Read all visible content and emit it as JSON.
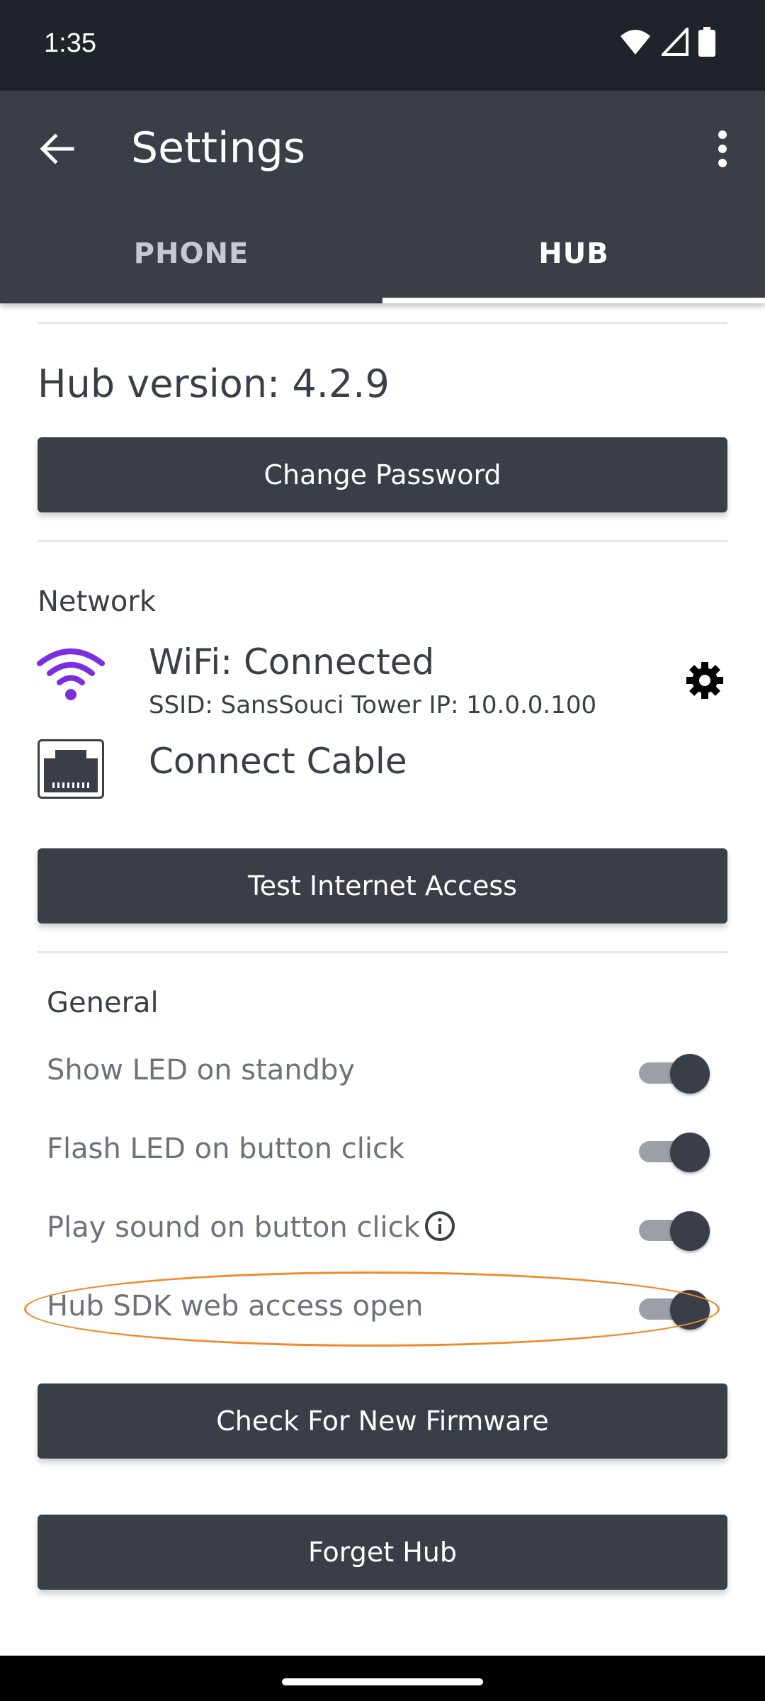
{
  "status_bar": {
    "time": "1:35"
  },
  "app_bar": {
    "title": "Settings"
  },
  "tabs": [
    {
      "label": "PHONE",
      "active": false
    },
    {
      "label": "HUB",
      "active": true
    }
  ],
  "hub": {
    "version_text": "Hub version: 4.2.9",
    "change_password_label": "Change Password"
  },
  "network": {
    "section_title": "Network",
    "wifi_status": "WiFi: Connected",
    "wifi_details": "SSID: SansSouci Tower      IP: 10.0.0.100",
    "cable_label": "Connect Cable",
    "test_internet_label": "Test Internet Access"
  },
  "general": {
    "section_title": "General",
    "settings": [
      {
        "label": "Show LED on standby",
        "enabled": true
      },
      {
        "label": "Flash LED on button click",
        "enabled": true
      },
      {
        "label": "Play sound on button click",
        "enabled": true
      },
      {
        "label": "Hub SDK web access open",
        "enabled": true
      }
    ]
  },
  "actions": {
    "check_firmware_label": "Check For New Firmware",
    "forget_hub_label": "Forget Hub"
  },
  "colors": {
    "app_bar": "#3a3f47",
    "status_bar": "#1f232a",
    "wifi_icon": "#7a2ee0",
    "highlight": "#f08a2a"
  }
}
